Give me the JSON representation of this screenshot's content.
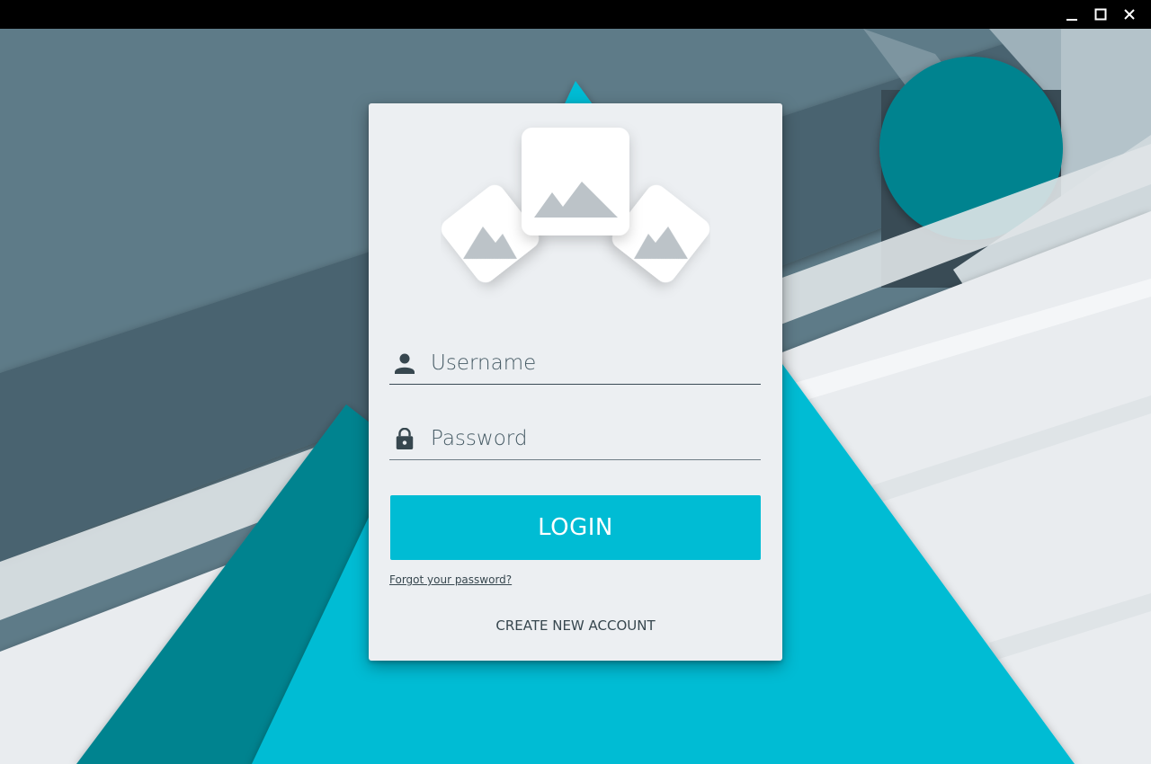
{
  "window": {
    "controls": {
      "minimize": "minimize-icon",
      "maximize": "maximize-icon",
      "close": "close-icon"
    }
  },
  "login": {
    "logo_icon": "image-gallery-icon",
    "username": {
      "placeholder": "Username",
      "value": "",
      "icon": "person-icon"
    },
    "password": {
      "placeholder": "Password",
      "value": "",
      "icon": "lock-icon"
    },
    "login_label": "LOGIN",
    "forgot_label": "Forgot your password?",
    "create_account_label": "CREATE NEW ACCOUNT"
  },
  "colors": {
    "accent": "#00bcd4",
    "accent_dark": "#00838f",
    "slate": "#5e7b88",
    "slate_dark": "#455a64",
    "card": "#eceff2",
    "text": "#37474f"
  }
}
